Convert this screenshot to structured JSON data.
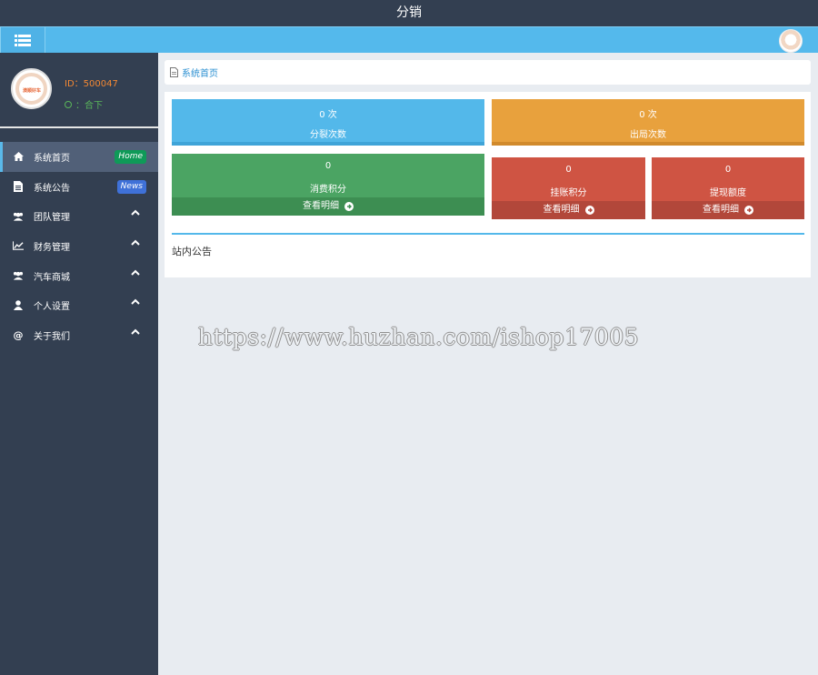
{
  "window": {
    "title": "分销"
  },
  "topbar": {
    "menu_icon": "list-icon",
    "avatar_icon": "avatar"
  },
  "profile": {
    "id_text": "ID：500047",
    "status_text": "：合下",
    "avatar_logo": "澳顺好车"
  },
  "sidebar": {
    "items": [
      {
        "label": "系统首页",
        "icon": "home-icon",
        "badge": "Home",
        "active": true
      },
      {
        "label": "系统公告",
        "icon": "document-icon",
        "badge": "News"
      },
      {
        "label": "团队管理",
        "icon": "users-icon"
      },
      {
        "label": "财务管理",
        "icon": "chart-line-icon"
      },
      {
        "label": "汽车商城",
        "icon": "users-icon"
      },
      {
        "label": "个人设置",
        "icon": "user-icon"
      },
      {
        "label": "关于我们",
        "icon": "at-icon"
      }
    ]
  },
  "breadcrumb": {
    "label": "系统首页"
  },
  "stats": [
    {
      "value": "0 次",
      "label": "分裂次数",
      "color": "#53b8ea"
    },
    {
      "value": "0 次",
      "label": "出局次数",
      "color": "#e8a13d"
    },
    {
      "value": "0",
      "label": "消费积分",
      "link": "查看明细",
      "color": "#4ba463"
    },
    {
      "value": "0",
      "label": "挂账积分",
      "link": "查看明细",
      "color": "#cf5443"
    },
    {
      "value": "0",
      "label": "提现额度",
      "link": "查看明细",
      "color": "#cf5443"
    }
  ],
  "notice": {
    "title": "站内公告"
  },
  "watermark": "https://www.huzhan.com/ishop17005"
}
